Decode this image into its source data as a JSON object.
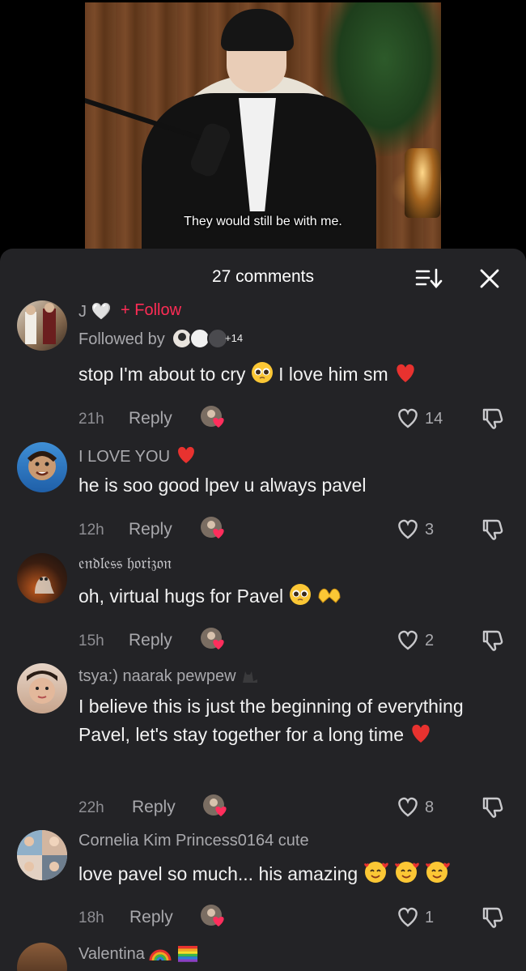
{
  "video": {
    "subtitle": "They would still be with me."
  },
  "sheet": {
    "count_label": "27 comments",
    "sort_icon": "sort-icon",
    "close_icon": "close-icon"
  },
  "comments": [
    {
      "username": "J 🤍",
      "follow_label": "+ Follow",
      "followed_by_label": "Followed by",
      "followed_by_count": "+14",
      "text": "stop I'm about to cry",
      "text_b": "I love him sm",
      "time": "21h",
      "reply_label": "Reply",
      "likes": "14"
    },
    {
      "username": "I LOVE YOU",
      "text": "he is soo good lpev u always pavel",
      "time": "12h",
      "reply_label": "Reply",
      "likes": "3"
    },
    {
      "username": "𝔢𝔫𝔡𝔩𝔢𝔰𝔰 𝔥𝔬𝔯𝔦𝔷𝔬𝔫",
      "text": "oh, virtual hugs for Pavel",
      "time": "15h",
      "reply_label": "Reply",
      "likes": "2"
    },
    {
      "username": "tsya:) naarak pewpew",
      "text": "I believe this is just the beginning of everything Pavel, let's stay together for a long time",
      "time": "22h",
      "reply_label": "Reply",
      "likes": "8"
    },
    {
      "username": "Cornelia Kim Princess0164 cute",
      "text": "love pavel so much... his amazing",
      "time": "18h",
      "reply_label": "Reply",
      "likes": "1"
    },
    {
      "username": "Valentina"
    }
  ],
  "colors": {
    "sheet_bg": "#232326",
    "follow_red": "#fe2c55",
    "heart_red": "#e8322f"
  }
}
